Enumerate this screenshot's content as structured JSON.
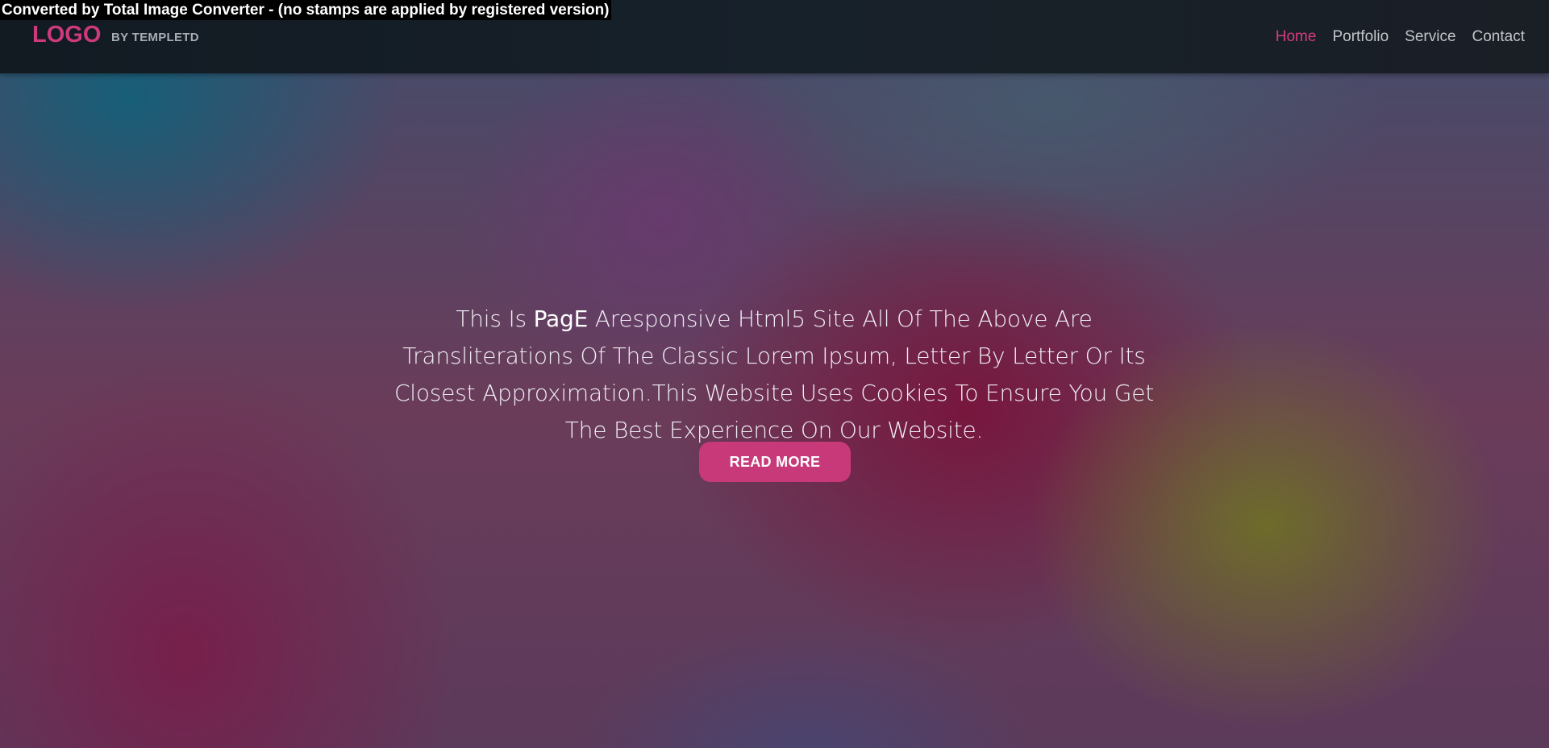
{
  "watermark": {
    "text": "Converted by Total Image Converter - (no stamps are applied by registered version)"
  },
  "header": {
    "logo": "LOGO",
    "byline": "BY TEMPLETD",
    "nav": [
      {
        "label": "Home",
        "active": true
      },
      {
        "label": "Portfolio",
        "active": false
      },
      {
        "label": "Service",
        "active": false
      },
      {
        "label": "Contact",
        "active": false
      }
    ]
  },
  "hero": {
    "text_before": "This Is ",
    "brand": "PagE",
    "text_after": " Aresponsive Html5 Site All Of The Above Are Transliterations Of The Classic Lorem Ipsum, Letter By Letter Or Its Closest Approximation.This Website Uses Cookies To Ensure You Get The Best Experience On Our Website.",
    "button_label": "READ MORE"
  },
  "colors": {
    "accent": "#c8397a",
    "nav_active": "#d23c80",
    "header_bg": "#151d25"
  }
}
